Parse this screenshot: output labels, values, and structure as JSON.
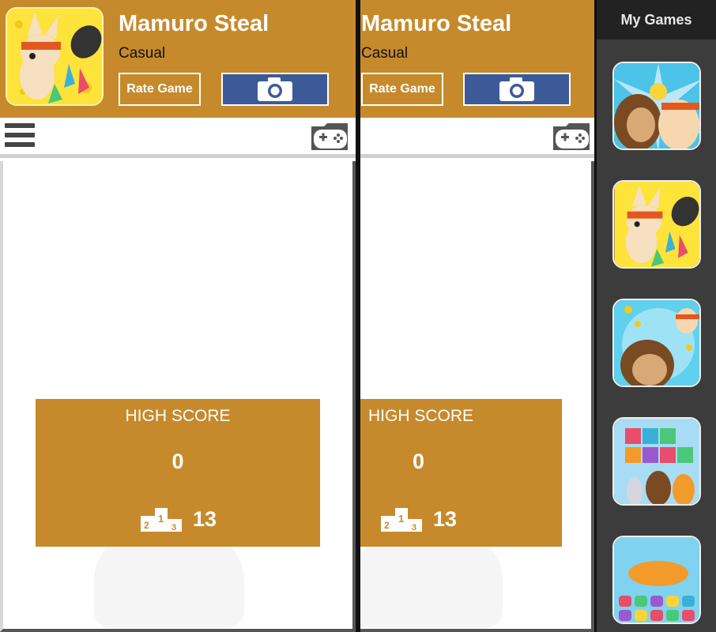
{
  "left_pane": {
    "title": "Mamuro Steal",
    "category": "Casual",
    "rate_label": "Rate Game",
    "high_score_label": "HIGH SCORE",
    "high_score_value": "0",
    "rank_value": "13"
  },
  "mid_pane": {
    "title": "Mamuro Steal",
    "category": "Casual",
    "rate_label": "Rate Game",
    "high_score_label": "HIGH SCORE",
    "high_score_value": "0",
    "rank_value": "13"
  },
  "sidebar": {
    "title": "My Games",
    "games": [
      {
        "icon": "monkey-vs-rabbit-icon"
      },
      {
        "icon": "mamuro-steal-icon"
      },
      {
        "icon": "monkey-coins-icon"
      },
      {
        "icon": "pet-link-icon"
      },
      {
        "icon": "candy-icon"
      }
    ]
  },
  "colors": {
    "accent": "#c68a2c",
    "facebook": "#3d5a98",
    "sidebar_bg": "#3c3c3c"
  }
}
